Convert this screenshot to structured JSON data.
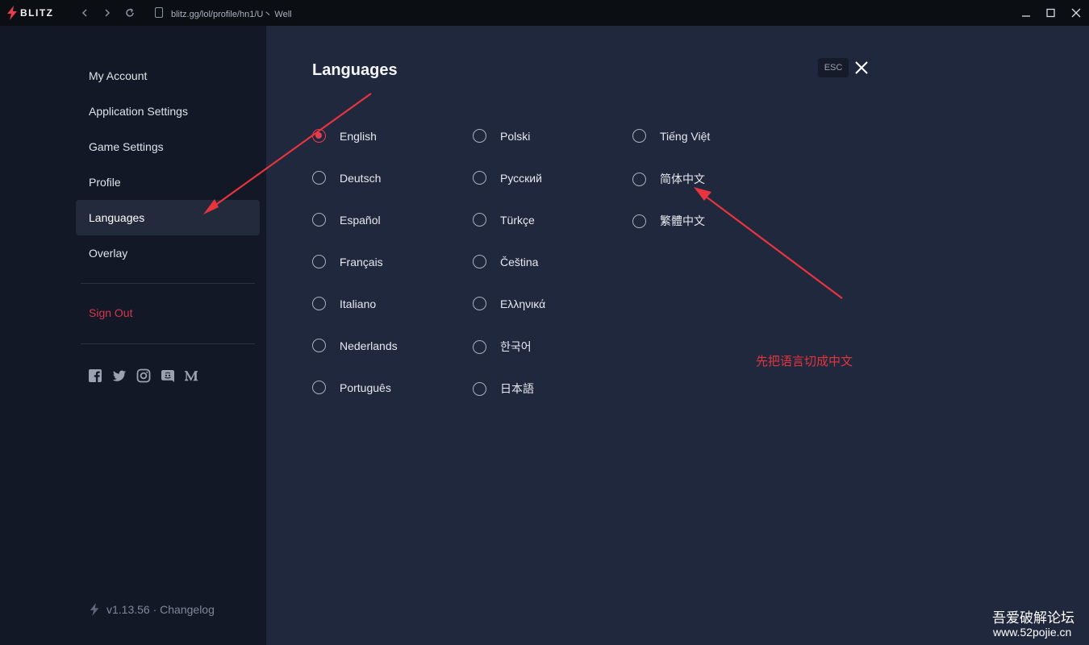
{
  "titlebar": {
    "brand": "BLITZ",
    "url": "blitz.gg/lol/profile/hn1/U丶 Well",
    "icons": [
      "bolt-icon",
      "back-icon",
      "forward-icon",
      "reload-icon",
      "page-icon",
      "minimize-icon",
      "maximize-icon",
      "close-icon"
    ]
  },
  "sidebar": {
    "items": [
      {
        "label": "My Account"
      },
      {
        "label": "Application Settings"
      },
      {
        "label": "Game Settings"
      },
      {
        "label": "Profile"
      },
      {
        "label": "Languages",
        "active": true
      },
      {
        "label": "Overlay"
      }
    ],
    "sign_out": "Sign Out",
    "social_icons": [
      "facebook-icon",
      "twitter-icon",
      "instagram-icon",
      "discord-icon",
      "medium-icon"
    ],
    "version": "v1.13.56 · Changelog"
  },
  "main": {
    "title": "Languages",
    "esc_label": "ESC",
    "selected": "English",
    "languages": [
      [
        "English",
        "Deutsch",
        "Español",
        "Français",
        "Italiano",
        "Nederlands",
        "Português"
      ],
      [
        "Polski",
        "Русский",
        "Türkçe",
        "Čeština",
        "Ελληνικά",
        "한국어",
        "日本語"
      ],
      [
        "Tiếng Việt",
        "简体中文",
        "繁體中文"
      ]
    ]
  },
  "annotation": {
    "text": "先把语言切成中文",
    "color": "#e3353f"
  },
  "watermark": {
    "line1": "吾爱破解论坛",
    "line2": "www.52pojie.cn"
  },
  "colors": {
    "accent": "#e33d4f",
    "sidebar_bg": "#121826",
    "main_bg": "#20283d"
  }
}
